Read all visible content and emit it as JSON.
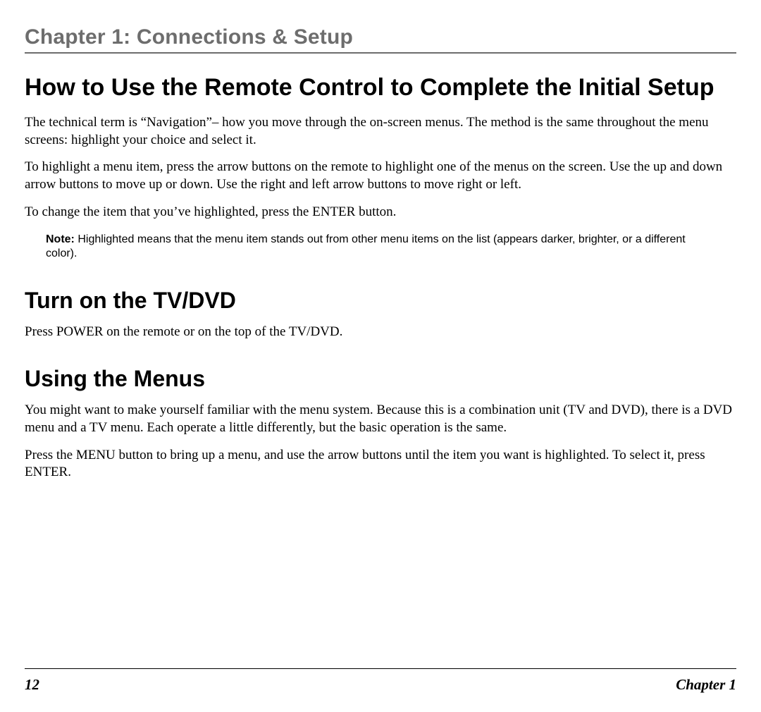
{
  "chapter_header": "Chapter 1: Connections & Setup",
  "section1": {
    "title": "How to Use the Remote Control to Complete the Initial Setup",
    "p1": "The technical term is “Navigation”– how you move through the on-screen menus. The method is the same throughout the menu screens: highlight your choice and select it.",
    "p2": "To highlight a menu item, press the arrow buttons on the remote to highlight one of the menus on the screen. Use the up and down arrow buttons to move up or down. Use the right and left arrow buttons to move right or left.",
    "p3": "To change the item that you’ve highlighted, press the ENTER button.",
    "note_label": "Note:",
    "note_body": " Highlighted means that the menu item stands out from other menu items on the list (appears darker, brighter, or a different color)."
  },
  "section2": {
    "title": "Turn on the TV/DVD",
    "p1": "Press POWER on the remote or on the top of the TV/DVD."
  },
  "section3": {
    "title": "Using the Menus",
    "p1": "You might want to make yourself familiar with the menu system. Because this is a combination unit (TV and DVD), there is a DVD menu and a TV menu. Each operate a little differently, but the basic operation is the same.",
    "p2": "Press the MENU button to bring up a menu, and use the arrow buttons until the item you want is highlighted. To select it, press ENTER."
  },
  "footer": {
    "page_number": "12",
    "chapter_label": "Chapter 1"
  }
}
